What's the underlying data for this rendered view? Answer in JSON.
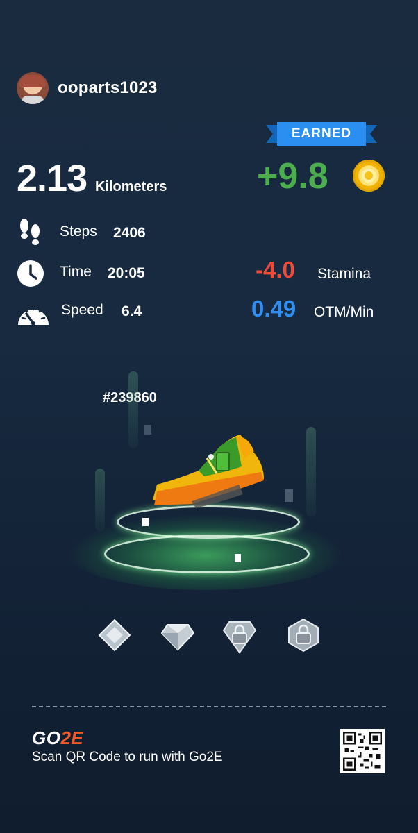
{
  "user": {
    "name": "ooparts1023"
  },
  "run": {
    "distance": "2.13",
    "distance_unit": "Kilometers",
    "steps_label": "Steps",
    "steps_value": "2406",
    "time_label": "Time",
    "time_value": "20:05",
    "speed_label": "Speed",
    "speed_value": "6.4"
  },
  "rewards": {
    "banner": "EARNED",
    "earned_value": "+9.8",
    "stamina_value": "-4.0",
    "stamina_label": "Stamina",
    "rate_value": "0.49",
    "rate_label": "OTM/Min"
  },
  "shoe": {
    "id": "#239860"
  },
  "gems": [
    "diamond-flat-icon",
    "diamond-icon",
    "locked-gem-icon",
    "locked-hex-icon"
  ],
  "footer": {
    "brand_go": "GO",
    "brand_z": "2E",
    "scan_text": "Scan QR Code to run with Go2E"
  },
  "colors": {
    "earned_green": "#4cae4f",
    "stamina_red": "#f04a3a",
    "rate_blue": "#2f8ef0",
    "banner_blue": "#2a8ff0",
    "brand_orange": "#f25a2a"
  }
}
